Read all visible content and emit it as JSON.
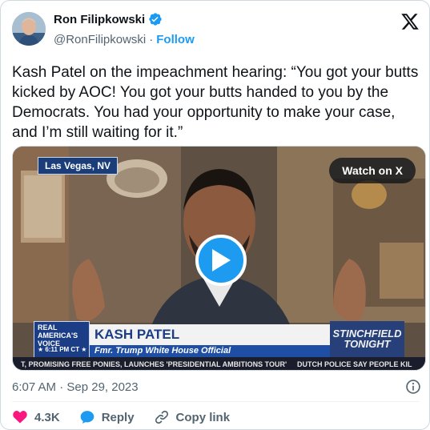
{
  "author": {
    "name": "Ron Filipkowski",
    "handle": "@RonFilipkowski",
    "separator": "·",
    "follow_label": "Follow"
  },
  "tweet": {
    "text": "Kash Patel on the impeachment hearing: “You got your butts kicked by AOC! You got your butts handed to you by the Democrats. You had your opportunity to make your case, and I’m still waiting for it.”"
  },
  "media": {
    "location_tag": "Las Vegas, NV",
    "watch_label": "Watch on X",
    "chyron": {
      "network_line1": "REAL",
      "network_line2": "AMERICA'S",
      "network_line3": "VOICE",
      "time": "★ 6:11 PM CT ★",
      "name": "KASH PATEL",
      "title": "Fmr. Trump White House Official",
      "show": "STINCHFIELD TONIGHT"
    },
    "ticker_left": "T, PROMISING FREE PONIES, LAUNCHES 'PRESIDENTIAL AMBITIONS TOUR'",
    "ticker_right": "DUTCH POLICE SAY PEOPLE KIL"
  },
  "timestamp": "6:07 AM · Sep 29, 2023",
  "actions": {
    "likes": "4.3K",
    "reply_label": "Reply",
    "copy_label": "Copy link"
  },
  "colors": {
    "accent": "#1d9bf0",
    "like": "#f91880",
    "secondary_text": "#536471"
  }
}
